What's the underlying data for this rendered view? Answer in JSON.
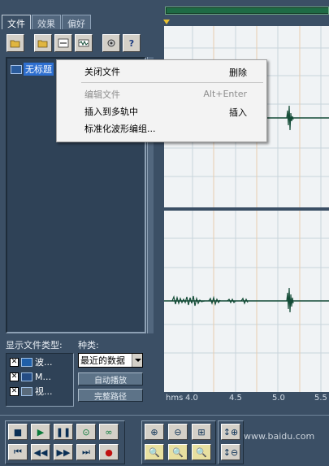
{
  "left_panel": {
    "tabs": [
      "文件",
      "效果",
      "偏好"
    ],
    "file_item": "无标题",
    "filter_label": "显示文件类型:",
    "kind_label": "种类:",
    "file_types": [
      "波...",
      "M...",
      "视..."
    ],
    "kind_selected": "最近的数据",
    "autoplay_label": "自动播放",
    "fullpath_label": "完整路径"
  },
  "context_menu": {
    "items": [
      {
        "label": "关闭文件",
        "shortcut": "删除",
        "disabled": false
      },
      {
        "label": "编辑文件",
        "shortcut": "Alt+Enter",
        "disabled": true
      },
      {
        "label": "插入到多轨中",
        "shortcut": "插入",
        "disabled": false
      },
      {
        "label": "标准化波形编组...",
        "shortcut": "",
        "disabled": false
      }
    ]
  },
  "ruler": {
    "unit": "hms",
    "ticks": [
      "4.0",
      "4.5",
      "5.0",
      "5.5"
    ]
  },
  "watermark": "www.baidu.com",
  "colors": {
    "panel": "#3b4f65",
    "waveform": "#134b36",
    "wave_bg": "#f0f3f5",
    "selection": "#2e6fd0"
  }
}
